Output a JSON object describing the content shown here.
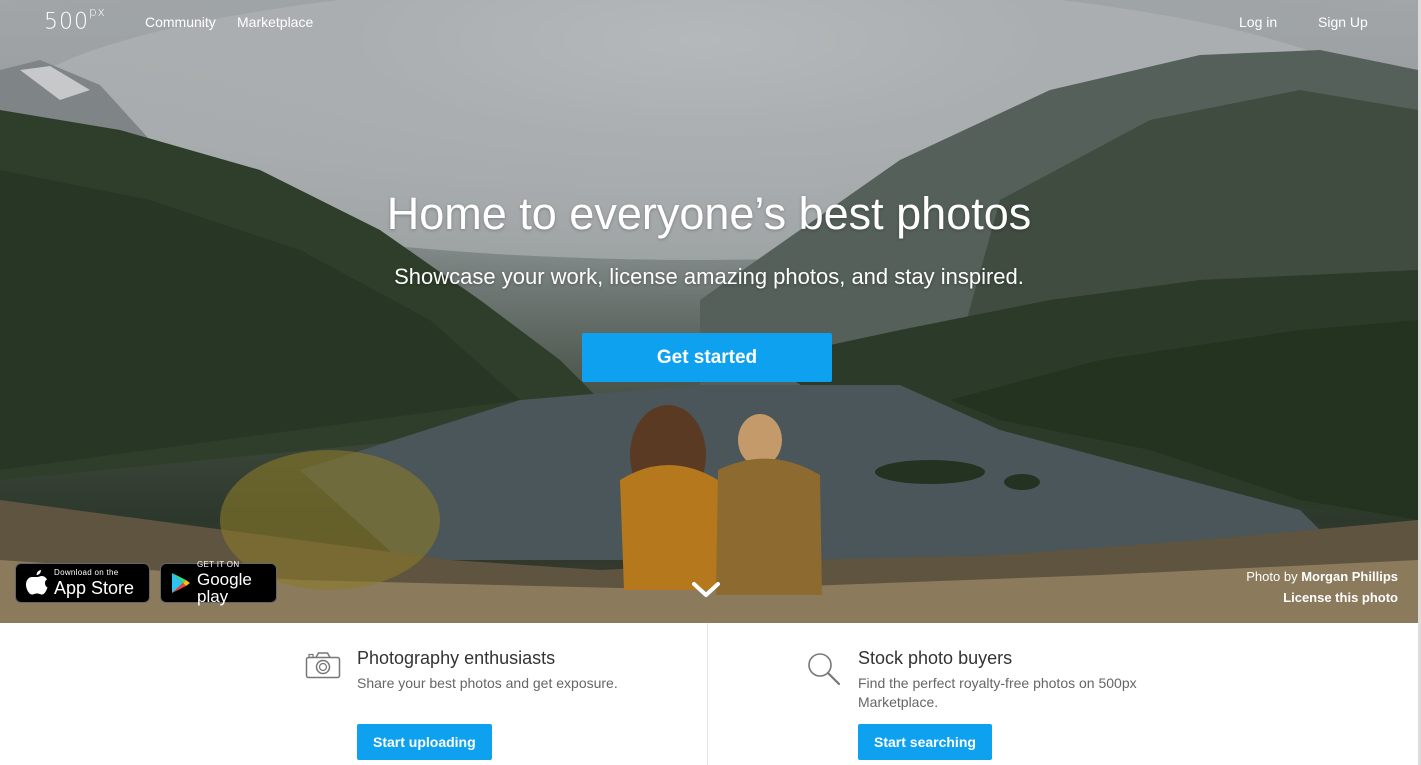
{
  "nav": {
    "logo": "500",
    "logo_suffix": "px",
    "community": "Community",
    "marketplace": "Marketplace",
    "login": "Log in",
    "signup": "Sign Up"
  },
  "hero": {
    "headline": "Home to everyone’s best photos",
    "subhead": "Showcase your work, license amazing photos, and stay inspired.",
    "cta": "Get started"
  },
  "badges": {
    "apple_small": "Download on the",
    "apple_large": "App Store",
    "google_small": "GET IT ON",
    "google_large": "Google play"
  },
  "credit": {
    "prefix": "Photo by",
    "photographer": "Morgan Phillips",
    "license": "License this photo"
  },
  "features": [
    {
      "icon": "camera-icon",
      "title": "Photography enthusiasts",
      "desc": "Share your best photos and get exposure.",
      "button": "Start uploading"
    },
    {
      "icon": "search-icon",
      "title": "Stock photo buyers",
      "desc": "Find the perfect royalty-free photos on 500px Marketplace.",
      "button": "Start searching"
    }
  ],
  "colors": {
    "accent": "#0ea1f0",
    "text_dark": "#333333",
    "text_muted": "#666666"
  }
}
